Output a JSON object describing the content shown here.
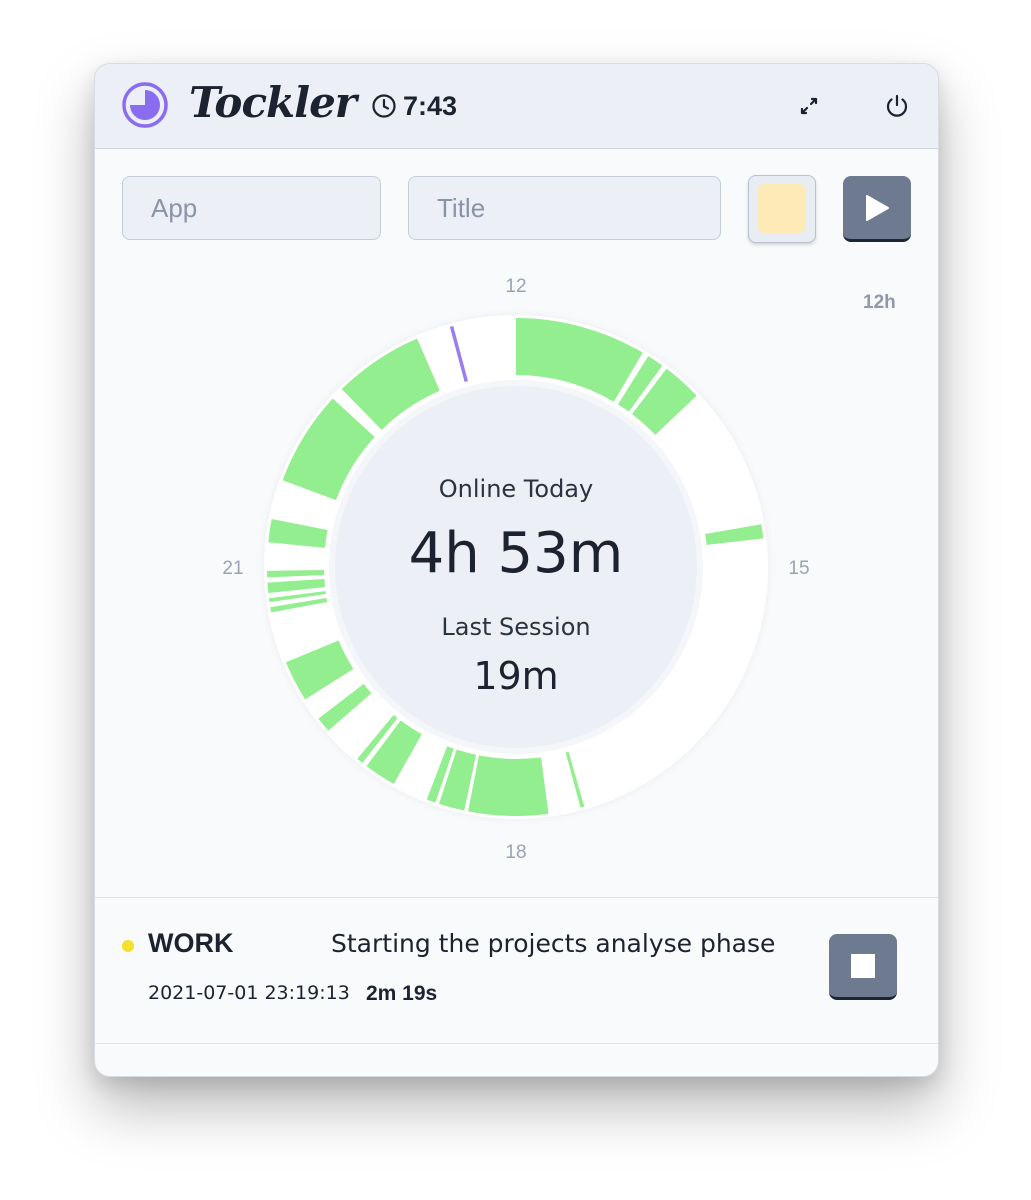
{
  "header": {
    "brand": "Tockler",
    "clock_time": "7:43",
    "logo_icon": "pie-logo-icon",
    "clock_icon": "clock-icon",
    "expand_icon": "expand-arrows-icon",
    "power_icon": "power-icon"
  },
  "filters": {
    "app_placeholder": "App",
    "title_placeholder": "Title",
    "color_value": "#fdeab7",
    "play_icon": "play-icon"
  },
  "clock_chart": {
    "range_label": "12h",
    "hour_labels": {
      "top": "12",
      "right": "15",
      "bottom": "18",
      "left": "21"
    },
    "online_label": "Online Today",
    "online_value": "4h 53m",
    "session_label": "Last Session",
    "session_value": "19m",
    "colors": {
      "online": "#92ee8e",
      "marker": "#9b7df0",
      "track": "#ffffff",
      "center": "#ecf0f6"
    }
  },
  "chart_data": {
    "type": "radial-timeline",
    "unit": "hour of day",
    "range": [
      12,
      24
    ],
    "tick_labels": [
      "12",
      "15",
      "18",
      "21"
    ],
    "online_segments": [
      [
        12.0,
        13.02
      ],
      [
        13.07,
        13.2
      ],
      [
        13.24,
        13.55
      ],
      [
        14.67,
        14.78
      ],
      [
        17.47,
        17.5
      ],
      [
        17.75,
        18.0
      ],
      [
        18.0,
        18.37
      ],
      [
        18.4,
        18.6
      ],
      [
        18.63,
        18.7
      ],
      [
        18.98,
        19.23
      ],
      [
        19.27,
        19.32
      ],
      [
        19.63,
        19.75
      ],
      [
        19.93,
        20.25
      ],
      [
        20.65,
        20.69
      ],
      [
        20.73,
        20.76
      ],
      [
        20.8,
        20.88
      ],
      [
        20.92,
        20.97
      ],
      [
        21.19,
        21.37
      ],
      [
        21.68,
        22.42
      ],
      [
        22.52,
        23.22
      ]
    ],
    "marker_hour": 23.5
  },
  "current_task": {
    "tag": "WORK",
    "tag_color": "#f6e02a",
    "title": "Starting the projects analyse phase",
    "start": "2021-07-01 23:19:13",
    "duration": "2m 19s",
    "stop_icon": "stop-icon"
  }
}
